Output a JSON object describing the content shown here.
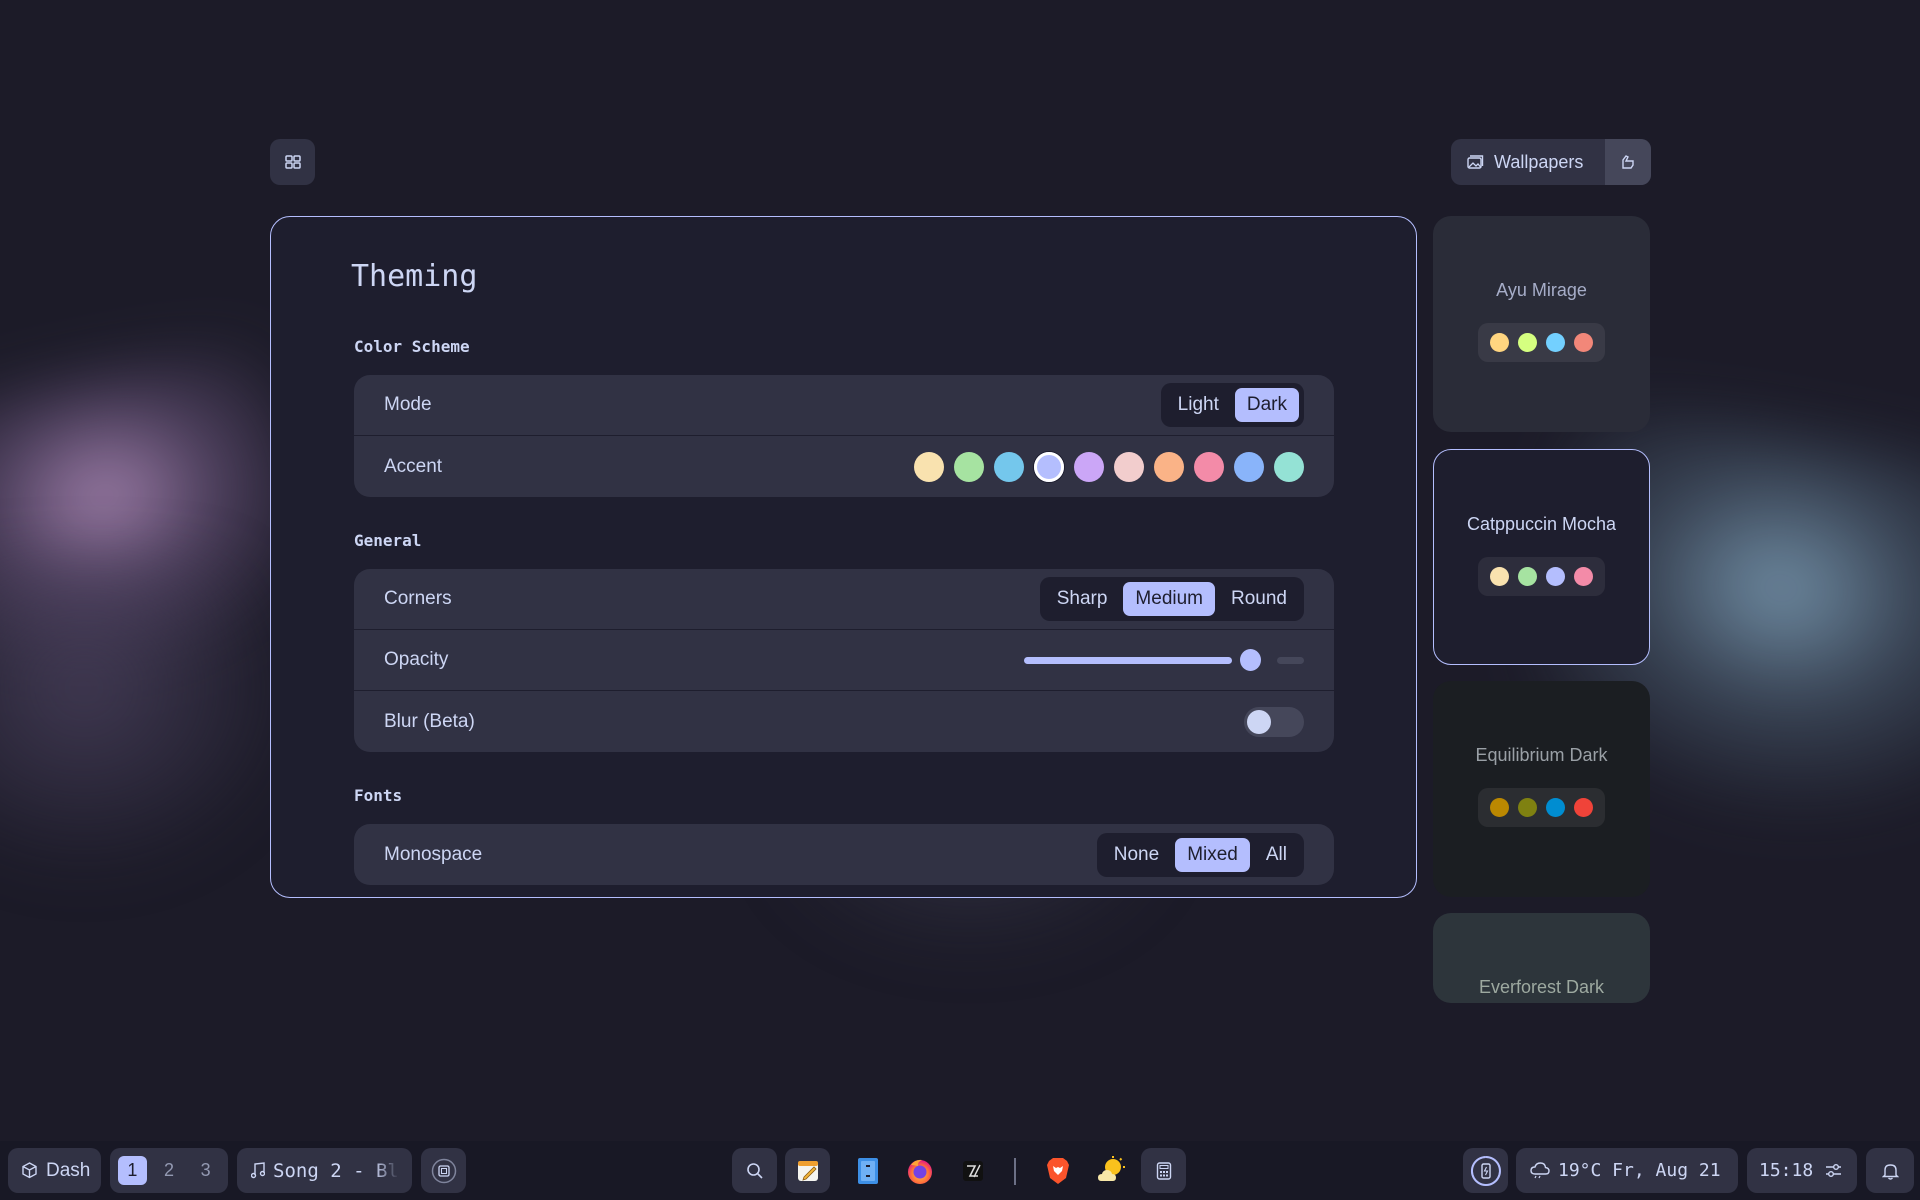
{
  "top": {
    "wallpapers_label": "Wallpapers"
  },
  "panel": {
    "title": "Theming",
    "sections": {
      "color_scheme": "Color Scheme",
      "general": "General",
      "fonts": "Fonts"
    },
    "mode": {
      "label": "Mode",
      "options": [
        "Light",
        "Dark"
      ],
      "selected": "Dark"
    },
    "accent": {
      "label": "Accent",
      "colors": [
        "#f9e2af",
        "#a6e3a1",
        "#74c7ec",
        "#b4befe",
        "#cba6f7",
        "#f2cdcd",
        "#fab387",
        "#f38ba8",
        "#89b4fa",
        "#94e2d5"
      ],
      "selected_index": 3
    },
    "corners": {
      "label": "Corners",
      "options": [
        "Sharp",
        "Medium",
        "Round"
      ],
      "selected": "Medium"
    },
    "opacity": {
      "label": "Opacity",
      "value_fraction": 0.85
    },
    "blur": {
      "label": "Blur (Beta)",
      "enabled": false
    },
    "monospace": {
      "label": "Monospace",
      "options": [
        "None",
        "Mixed",
        "All"
      ],
      "selected": "Mixed"
    }
  },
  "themes": [
    {
      "name": "Ayu Mirage",
      "bg": "#2a2c38",
      "text": "#a6adc8",
      "colors": [
        "#ffd580",
        "#d5ff80",
        "#73d0ff",
        "#f28779"
      ]
    },
    {
      "name": "Catppuccin Mocha",
      "bg": "#1e1e2e",
      "text": "#cdd6f4",
      "colors": [
        "#f9e2af",
        "#a6e3a1",
        "#b4befe",
        "#f38ba8"
      ],
      "active": true
    },
    {
      "name": "Equilibrium Dark",
      "bg": "#1b1e22",
      "text": "#9aa0a6",
      "colors": [
        "#bb8801",
        "#7f8111",
        "#008dd1",
        "#f04339"
      ]
    },
    {
      "name": "Everforest Dark",
      "bg": "#2d353b",
      "text": "#9da9a0",
      "colors": []
    }
  ],
  "taskbar": {
    "dash_label": "Dash",
    "workspaces": [
      "1",
      "2",
      "3"
    ],
    "active_workspace": "1",
    "media": "Song 2 - Bl",
    "weather": "19°C Fr, Aug 21",
    "clock": "15:18"
  },
  "icons": {
    "grid": "grid-icon",
    "wallpapers": "image-icon",
    "paint": "paintbrush-icon",
    "dash": "cube-icon",
    "music": "music-note-icon",
    "cpu": "cpu-icon",
    "search": "search-icon",
    "notes": "notes-app-icon",
    "files": "file-manager-icon",
    "firefox": "firefox-icon",
    "editor": "text-editor-icon",
    "brave": "brave-icon",
    "weather_app": "weather-app-icon",
    "calculator": "calculator-icon",
    "battery": "battery-icon",
    "cloud": "cloud-icon",
    "sliders": "sliders-icon",
    "bell": "bell-icon"
  }
}
